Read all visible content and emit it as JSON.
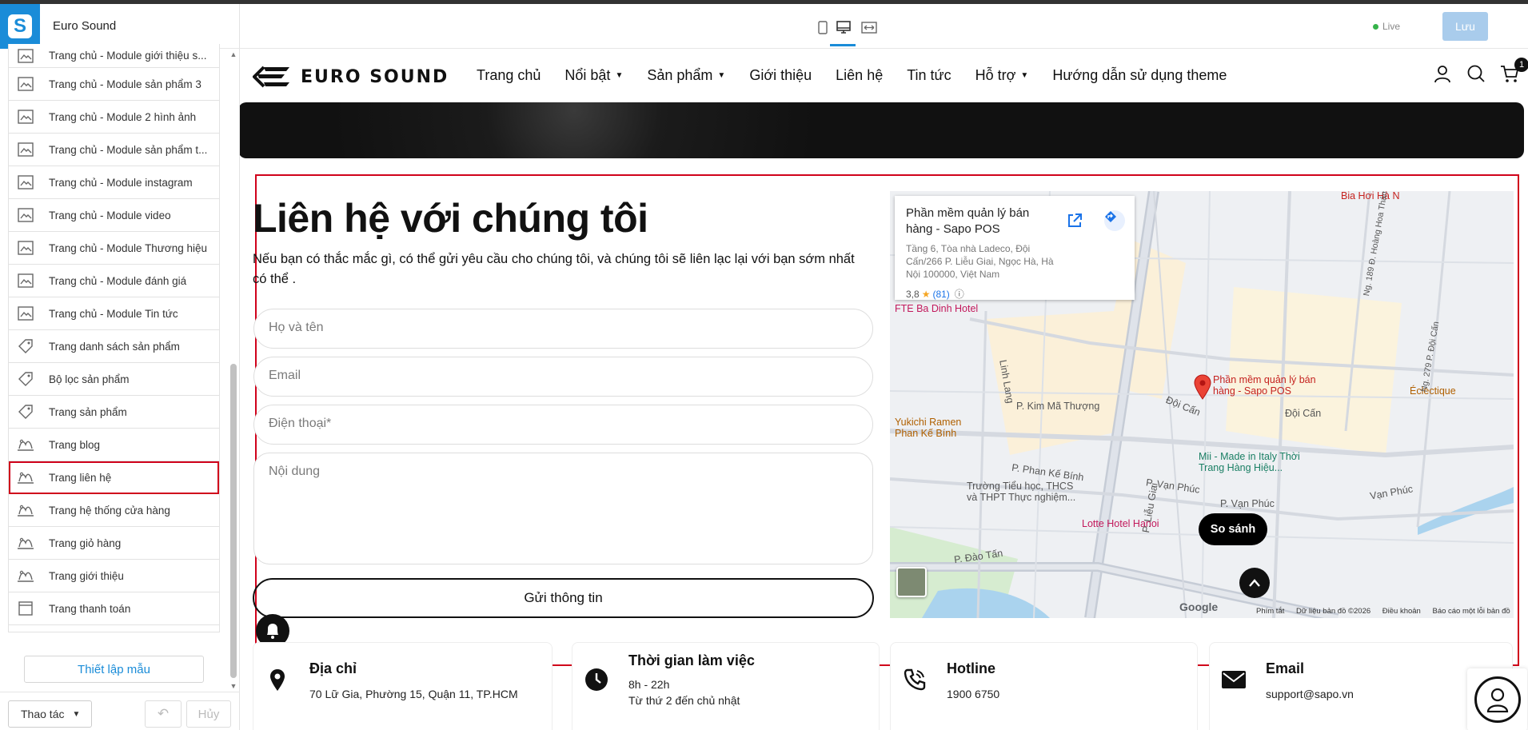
{
  "app": {
    "store_name": "Euro Sound",
    "logo_letter": "S"
  },
  "sidebar": {
    "items": [
      {
        "label": "Trang chủ - Module giới thiệu s...",
        "icon": "layout-icon"
      },
      {
        "label": "Trang chủ - Module sản phẩm 3",
        "icon": "layout-icon"
      },
      {
        "label": "Trang chủ - Module 2 hình ảnh",
        "icon": "layout-icon"
      },
      {
        "label": "Trang chủ - Module sản phẩm t...",
        "icon": "layout-icon"
      },
      {
        "label": "Trang chủ - Module instagram",
        "icon": "layout-icon"
      },
      {
        "label": "Trang chủ - Module video",
        "icon": "layout-icon"
      },
      {
        "label": "Trang chủ - Module Thương hiệu",
        "icon": "layout-icon"
      },
      {
        "label": "Trang chủ - Module đánh giá",
        "icon": "layout-icon"
      },
      {
        "label": "Trang chủ - Module Tin tức",
        "icon": "layout-icon"
      },
      {
        "label": "Trang danh sách sản phẩm",
        "icon": "tag-icon"
      },
      {
        "label": "Bộ lọc sản phẩm",
        "icon": "tag-icon"
      },
      {
        "label": "Trang sản phẩm",
        "icon": "tag-icon"
      },
      {
        "label": "Trang blog",
        "icon": "page-icon"
      },
      {
        "label": "Trang liên hệ",
        "icon": "page-icon",
        "selected": true
      },
      {
        "label": "Trang hệ thống cửa hàng",
        "icon": "page-icon"
      },
      {
        "label": "Trang giỏ hàng",
        "icon": "page-icon"
      },
      {
        "label": "Trang giới thiệu",
        "icon": "page-icon"
      },
      {
        "label": "Trang thanh toán",
        "icon": "checkout-icon"
      }
    ],
    "setup_button": "Thiết lập mẫu",
    "action_button": "Thao tác",
    "cancel_button": "Hủy"
  },
  "toolbar": {
    "devices": [
      "mobile-icon",
      "desktop-icon",
      "fullwidth-icon"
    ],
    "active_device": "desktop-icon",
    "live_label": "Live",
    "save_label": "Lưu"
  },
  "site": {
    "logo_text": "EURO SOUND",
    "menu": [
      {
        "label": "Trang chủ",
        "dropdown": false
      },
      {
        "label": "Nổi bật",
        "dropdown": true
      },
      {
        "label": "Sản phẩm",
        "dropdown": true
      },
      {
        "label": "Giới thiệu",
        "dropdown": false
      },
      {
        "label": "Liên hệ",
        "dropdown": false
      },
      {
        "label": "Tin tức",
        "dropdown": false
      },
      {
        "label": "Hỗ trợ",
        "dropdown": true
      },
      {
        "label": "Hướng dẫn sử dụng theme",
        "dropdown": false
      }
    ],
    "cart_count": "1",
    "contact": {
      "title": "Liên hệ với chúng tôi",
      "description": "Nếu bạn có thắc mắc gì, có thể gửi yêu cầu cho chúng tôi, và chúng tôi sẽ liên lạc lại với bạn sớm nhất có thể .",
      "name_placeholder": "Họ và tên",
      "email_placeholder": "Email",
      "phone_placeholder": "Điện thoại*",
      "message_placeholder": "Nội dung",
      "submit": "Gửi thông tin"
    },
    "map": {
      "place_title": "Phần mềm quản lý bán hàng - Sapo POS",
      "place_address": "Tầng 6, Tòa nhà Ladeco, Đội Cấn/266 P. Liễu Giai, Ngọc Hà, Hà Nội 100000, Việt Nam",
      "rating": "3,8",
      "reviews": "(81)",
      "marker_label": "Phần mềm quản lý bán hàng - Sapo POS",
      "labels": {
        "bia_hoi": "Bia Hơi Hà N",
        "hotel": "FTE Ba Dinh Hotel",
        "linh_lang": "Linh Lang",
        "kim_ma": "P. Kim Mã Thượng",
        "yukichi": "Yukichi Ramen Phan Kế Bính",
        "phan_ke_binh": "P. Phan Kế Bính",
        "van_phuc": "P. Vạn Phúc",
        "van_phuc2": "P. Vạn Phúc",
        "van_phuc3": "Vạn Phúc",
        "doi_can": "Đội Cấn",
        "doi_can2": "Đội Cấn",
        "eclectique": "Éclectique",
        "mii": "Mii - Made in Italy Thời Trang Hàng Hiệu...",
        "truong": "Trường Tiểu học, THCS và THPT Thực nghiệm...",
        "lotte": "Lotte Hotel Hanoi",
        "dao_tan": "P. Đào Tấn",
        "lieu_giai": "P. Liễu Giai",
        "hoang_hoa_tham": "Ng. 189 Đ. Hoàng Hoa Thám",
        "ng279": "Ng. 279 P. Đội Cấn"
      },
      "google": "Google",
      "footer": [
        "Phím tắt",
        "Dữ liệu bản đồ ©2026",
        "Điều khoản",
        "Báo cáo một lỗi bản đồ"
      ]
    },
    "compare": "So sánh",
    "cards": [
      {
        "title": "Địa chỉ",
        "line1": "70 Lữ Gia, Phường 15, Quận 11, TP.HCM",
        "line2": "",
        "icon": "location-pin-icon"
      },
      {
        "title": "Thời gian làm việc",
        "line1": "8h - 22h",
        "line2": "Từ thứ 2 đến chủ nhật",
        "icon": "clock-icon"
      },
      {
        "title": "Hotline",
        "line1": "1900 6750",
        "line2": "",
        "icon": "phone-icon"
      },
      {
        "title": "Email",
        "line1": "support@sapo.vn",
        "line2": "",
        "icon": "mail-icon"
      }
    ]
  }
}
